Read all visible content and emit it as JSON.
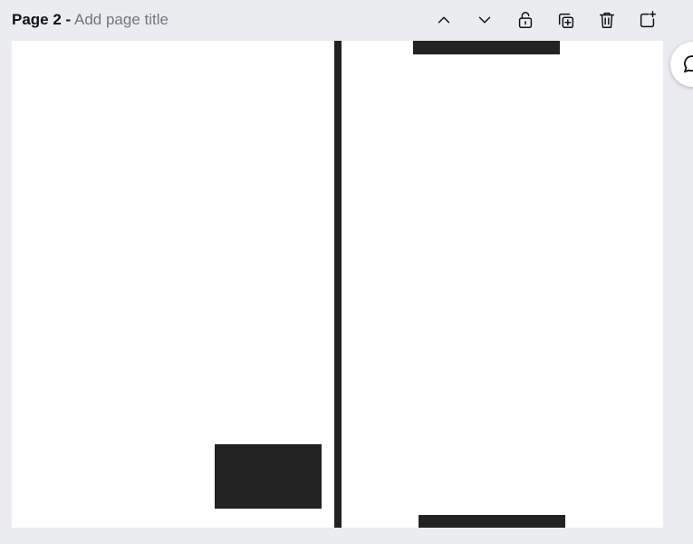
{
  "page_header": {
    "page_number_label": "Page 2 -",
    "title_placeholder": "Add page title"
  },
  "toolbar": {
    "buttons": [
      {
        "name": "move-page-up",
        "icon": "chevron-up-icon"
      },
      {
        "name": "move-page-down",
        "icon": "chevron-down-icon"
      },
      {
        "name": "lock-page",
        "icon": "unlock-icon"
      },
      {
        "name": "duplicate-page",
        "icon": "duplicate-icon"
      },
      {
        "name": "delete-page",
        "icon": "trash-icon"
      },
      {
        "name": "add-page",
        "icon": "add-page-icon"
      }
    ]
  },
  "canvas": {
    "background": "#ffffff",
    "shape_color": "#222222"
  },
  "side_panel": {
    "icon": "comment-icon"
  },
  "colors": {
    "workspace_bg": "#ebecf0",
    "icon_color": "#0e1318",
    "placeholder_color": "#70757e"
  }
}
